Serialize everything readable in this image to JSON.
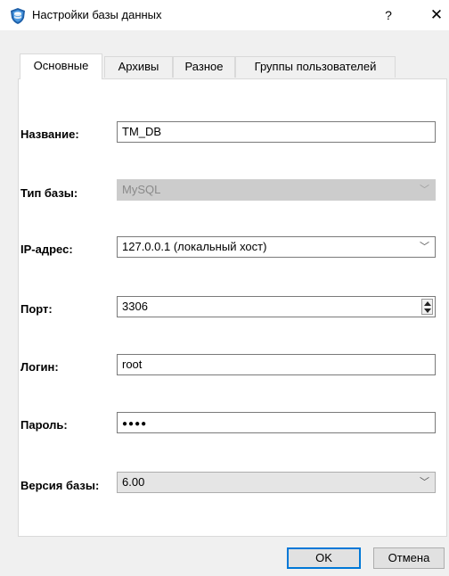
{
  "window": {
    "title": "Настройки базы данных",
    "help_label": "?",
    "close_label": "✕"
  },
  "tabs": [
    {
      "label": "Основные",
      "active": true
    },
    {
      "label": "Архивы",
      "active": false
    },
    {
      "label": "Разное",
      "active": false
    },
    {
      "label": "Группы пользователей",
      "active": false
    }
  ],
  "form": {
    "name": {
      "label": "Название:",
      "value": "TM_DB"
    },
    "db_type": {
      "label": "Тип базы:",
      "value": "MySQL",
      "disabled": true
    },
    "ip": {
      "label": "IP-адрес:",
      "value": "127.0.0.1 (локальный хост)"
    },
    "port": {
      "label": "Порт:",
      "value": "3306"
    },
    "login": {
      "label": "Логин:",
      "value": "root"
    },
    "password": {
      "label": "Пароль:",
      "value": "●●●●"
    },
    "version": {
      "label": "Версия базы:",
      "value": "6.00"
    }
  },
  "buttons": {
    "ok": "OK",
    "cancel": "Отмена"
  },
  "icons": {
    "app": "database-shield-icon",
    "chevron": "chevron-down-icon"
  },
  "colors": {
    "accent": "#0078d7",
    "disabled_bg": "#cccccc",
    "disabled_text": "#8a8a8a"
  }
}
